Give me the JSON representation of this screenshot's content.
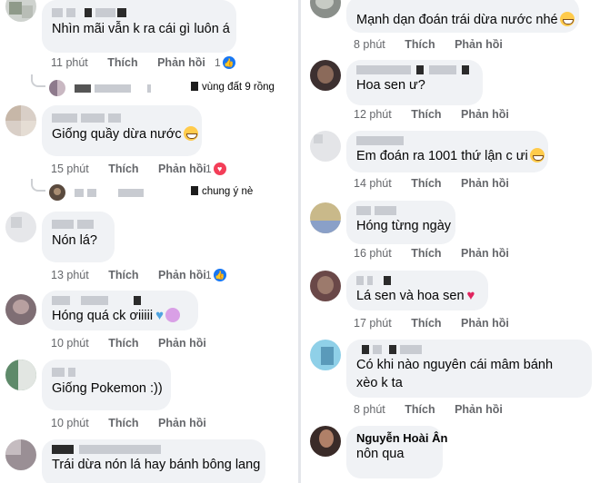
{
  "left": {
    "comments": [
      {
        "text": "Nhìn mãi vẫn k ra cái gì luôn á",
        "time": "11 phút",
        "like": "Thích",
        "reply": "Phản hồi",
        "reaction_count": "1",
        "reaction": "like"
      },
      {
        "reply_text": "vùng đất 9 rồng"
      },
      {
        "text": "Giống quầy dừa nước",
        "time": "15 phút",
        "like": "Thích",
        "reply": "Phản hồi",
        "reaction_count": "1",
        "reaction": "love"
      },
      {
        "reply_text": "chung ý nè"
      },
      {
        "text": "Nón lá?",
        "time": "13 phút",
        "like": "Thích",
        "reply": "Phản hồi",
        "reaction_count": "1",
        "reaction": "like"
      },
      {
        "text": "Hóng quá ck ơiiiii",
        "time": "10 phút",
        "like": "Thích",
        "reply": "Phản hồi"
      },
      {
        "text": "Giống Pokemon :))",
        "time": "10 phút",
        "like": "Thích",
        "reply": "Phản hồi"
      },
      {
        "text": "Trái dừa nón lá hay bánh bông lang"
      }
    ]
  },
  "right": {
    "comments": [
      {
        "text": "Mạnh dạn đoán trái dừa nước nhé",
        "time": "8 phút",
        "like": "Thích",
        "reply": "Phản hồi"
      },
      {
        "text": "Hoa sen ư?",
        "time": "12 phút",
        "like": "Thích",
        "reply": "Phản hồi"
      },
      {
        "text": "Em đoán ra 1001 thứ lận c ưi",
        "time": "14 phút",
        "like": "Thích",
        "reply": "Phản hồi"
      },
      {
        "text": "Hóng từng ngày",
        "time": "16 phút",
        "like": "Thích",
        "reply": "Phản hồi"
      },
      {
        "text": "Lá sen và hoa sen",
        "time": "17 phút",
        "like": "Thích",
        "reply": "Phản hồi"
      },
      {
        "text": "Có khi nào nguyên cái mâm bánh xèo k ta",
        "time": "8 phút",
        "like": "Thích",
        "reply": "Phản hồi"
      },
      {
        "name": "Nguyễn Hoài Ân",
        "text": "nôn qua"
      }
    ]
  },
  "icons": {
    "like": "like-icon",
    "love": "heart-icon"
  },
  "colors": {
    "bubble": "#f0f2f5",
    "meta_text": "#65676b",
    "like_blue": "#1877f2",
    "love_red": "#f33e58"
  }
}
